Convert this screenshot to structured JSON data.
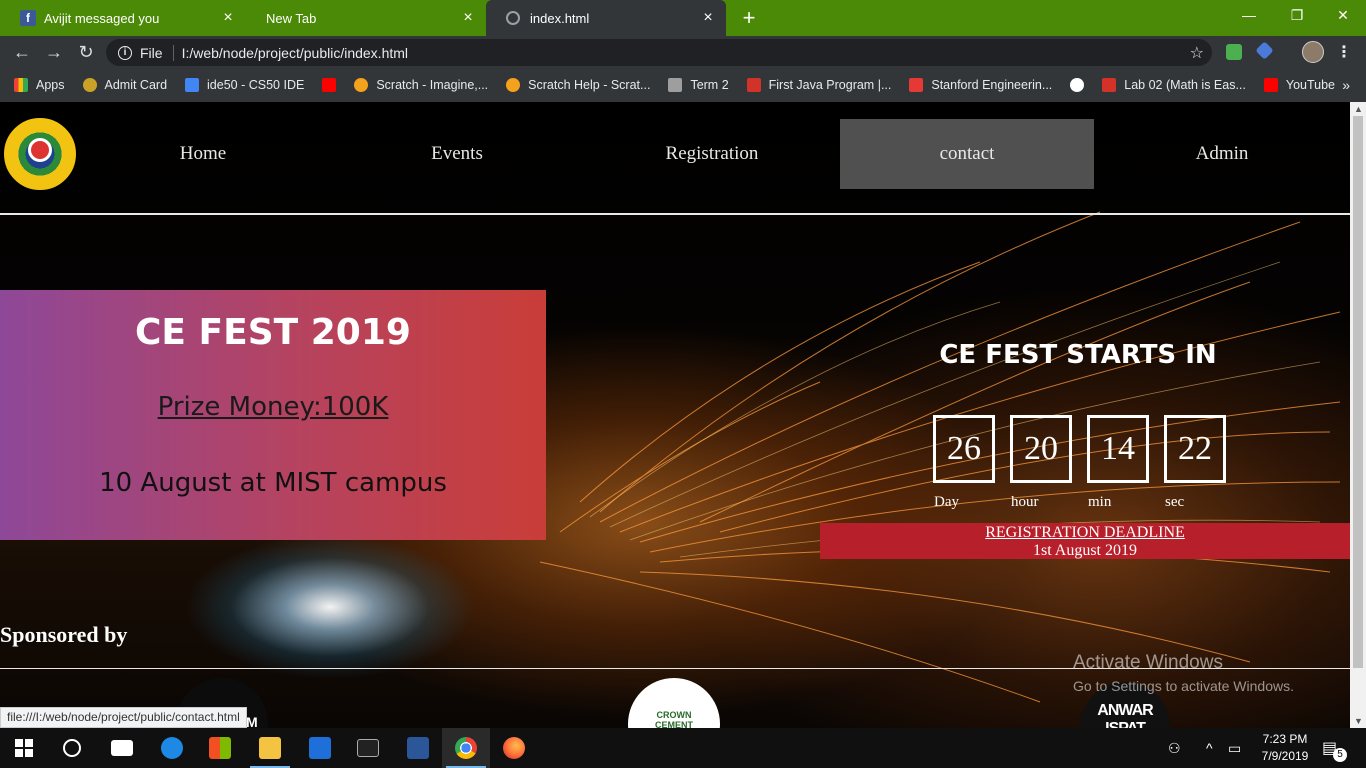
{
  "browser": {
    "tabs": [
      {
        "title": "Avijit messaged you",
        "icon": "facebook-icon"
      },
      {
        "title": "New Tab",
        "icon": ""
      },
      {
        "title": "index.html",
        "icon": "globe-icon"
      }
    ],
    "url_scheme": "File",
    "url": "I:/web/node/project/public/index.html",
    "bookmarks": [
      {
        "label": "Apps",
        "icon": "apps-grid-icon",
        "color": "#ea4335"
      },
      {
        "label": "Admit Card",
        "icon": "admit-card-icon",
        "color": "#c9a227"
      },
      {
        "label": "ide50 - CS50 IDE",
        "icon": "cloud9-icon",
        "color": "#4285f4"
      },
      {
        "label": "",
        "icon": "youtube-icon",
        "color": "#ff0000"
      },
      {
        "label": "Scratch - Imagine,...",
        "icon": "scratch-icon",
        "color": "#f4a11d"
      },
      {
        "label": "Scratch Help - Scrat...",
        "icon": "scratch-icon",
        "color": "#f4a11d"
      },
      {
        "label": "Term 2",
        "icon": "document-icon",
        "color": "#9e9e9e"
      },
      {
        "label": "First Java Program |...",
        "icon": "edx-icon",
        "color": "#d23228"
      },
      {
        "label": "Stanford Engineerin...",
        "icon": "stanford-icon",
        "color": "#e53935"
      },
      {
        "label": "",
        "icon": "globe-icon",
        "color": "#ffffff"
      },
      {
        "label": "Lab 02 (Math is Eas...",
        "icon": "edx-icon",
        "color": "#d23228"
      },
      {
        "label": "YouTube",
        "icon": "youtube-icon",
        "color": "#ff0000"
      }
    ]
  },
  "site": {
    "nav": [
      {
        "label": "Home",
        "active": false
      },
      {
        "label": "Events",
        "active": false
      },
      {
        "label": "Registration",
        "active": false
      },
      {
        "label": "contact",
        "active": true
      },
      {
        "label": "Admin",
        "active": false
      }
    ],
    "promo": {
      "title": "CE FEST 2019",
      "prize": "Prize Money:100K",
      "date": "10 August at MIST campus"
    },
    "countdown": {
      "title": "CE FEST STARTS IN",
      "units": [
        {
          "value": "26",
          "label": "Day"
        },
        {
          "value": "20",
          "label": "hour"
        },
        {
          "value": "14",
          "label": "min"
        },
        {
          "value": "22",
          "label": "sec"
        }
      ]
    },
    "deadline": {
      "title": "REGISTRATION DEADLINE",
      "date": "1st August 2019"
    },
    "sponsored_label": "Sponsored by",
    "sponsors": {
      "crown_text": "CROWN CEMENT",
      "anwar_text": "ANWAR ISPAT",
      "dark_letter": "M"
    }
  },
  "status_link": "file:///I:/web/node/project/public/contact.html",
  "watermark": {
    "title": "Activate Windows",
    "subtitle": "Go to Settings to activate Windows."
  },
  "taskbar": {
    "time": "7:23 PM",
    "date": "7/9/2019",
    "notifications": "5"
  },
  "colors": {
    "tabstrip": "#4b8a06",
    "chrome_dark": "#323639",
    "promo_start": "#8e4898",
    "promo_end": "#c93d38",
    "deadline_bg": "#b7202a",
    "nav_active": "#505050"
  }
}
